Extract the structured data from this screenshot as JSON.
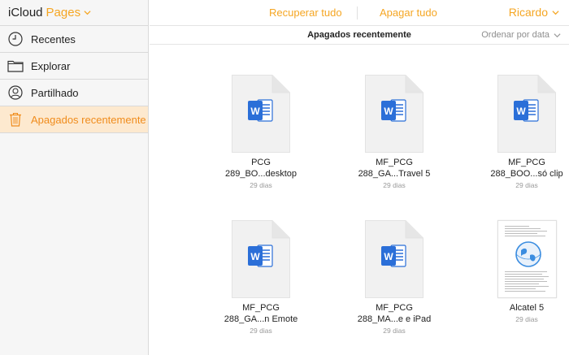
{
  "brand": {
    "icloud": "iCloud",
    "app": "Pages"
  },
  "sidebar": {
    "items": [
      {
        "label": "Recentes",
        "icon": "clock-icon"
      },
      {
        "label": "Explorar",
        "icon": "folder-icon"
      },
      {
        "label": "Partilhado",
        "icon": "person-icon"
      },
      {
        "label": "Apagados recentemente",
        "icon": "trash-icon"
      }
    ],
    "active_index": 3
  },
  "toolbar": {
    "recover_all": "Recuperar tudo",
    "delete_all": "Apagar tudo",
    "user": "Ricardo"
  },
  "subheader": {
    "section_title": "Apagados recentemente",
    "sort_label": "Ordenar por data"
  },
  "files": [
    {
      "line1": "PCG",
      "line2": "289_BO...desktop",
      "age": "29 dias",
      "type": "word"
    },
    {
      "line1": "MF_PCG",
      "line2": "288_GA...Travel 5",
      "age": "29 dias",
      "type": "word"
    },
    {
      "line1": "MF_PCG",
      "line2": "288_BOO...só clip",
      "age": "29 dias",
      "type": "word"
    },
    {
      "line1": "MF_PCG",
      "line2": "288_GA...n Emote",
      "age": "29 dias",
      "type": "word"
    },
    {
      "line1": "MF_PCG",
      "line2": "288_MA...e e iPad",
      "age": "29 dias",
      "type": "word"
    },
    {
      "line1": "Alcatel 5",
      "line2": "",
      "age": "29 dias",
      "type": "document"
    }
  ],
  "colors": {
    "accent": "#f5a623",
    "active_bg": "#fde9cf",
    "word_blue": "#2b6fd8"
  }
}
